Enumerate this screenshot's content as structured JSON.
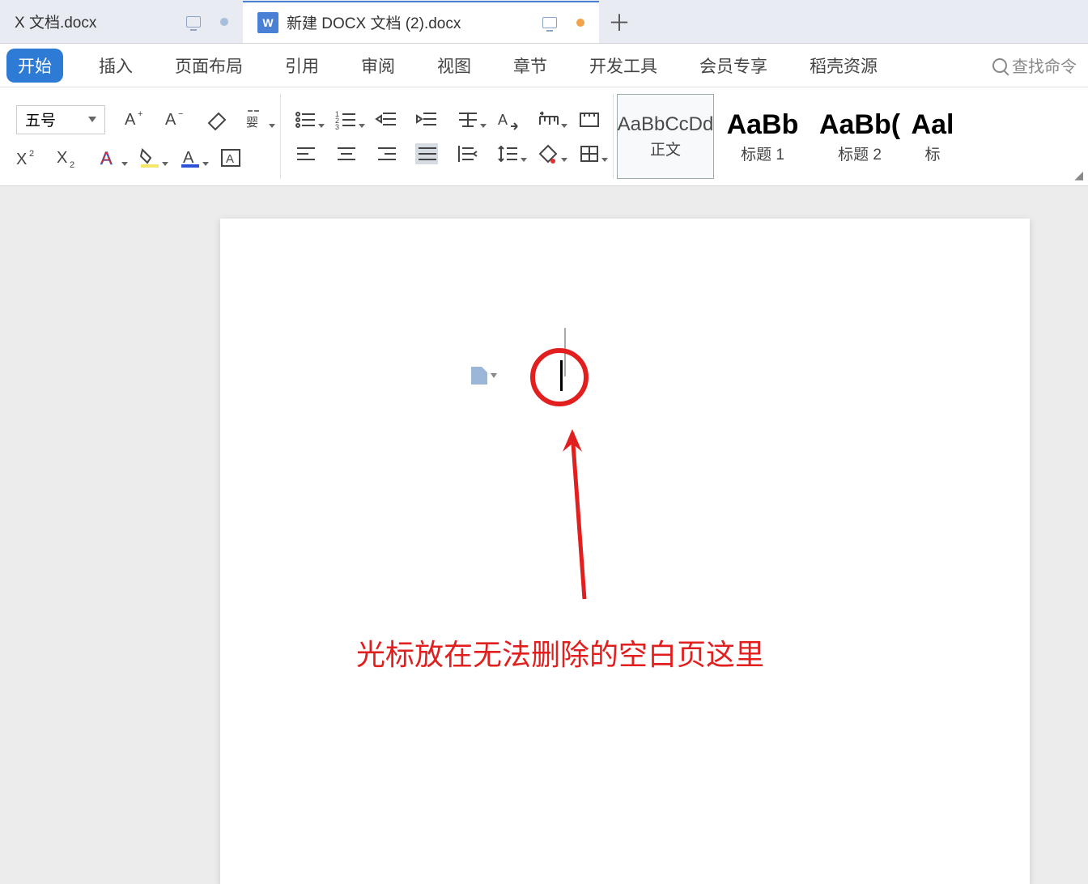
{
  "tabs": {
    "inactive_title": "X 文档.docx",
    "active_title": "新建 DOCX 文档 (2).docx"
  },
  "menu": {
    "start": "开始",
    "insert": "插入",
    "page_layout": "页面布局",
    "references": "引用",
    "review": "审阅",
    "view": "视图",
    "chapter": "章节",
    "dev_tools": "开发工具",
    "member": "会员专享",
    "docer": "稻壳资源",
    "search_cmd": "查找命令"
  },
  "ribbon": {
    "font_size": "五号"
  },
  "styles": {
    "normal_preview": "AaBbCcDd",
    "normal_label": "正文",
    "h1_preview": "AaBb",
    "h1_label": "标题 1",
    "h2_preview": "AaBb(",
    "h2_label": "标题 2",
    "h3_preview": "Aal",
    "h3_label": "标"
  },
  "annotation": {
    "text": "光标放在无法删除的空白页这里"
  }
}
